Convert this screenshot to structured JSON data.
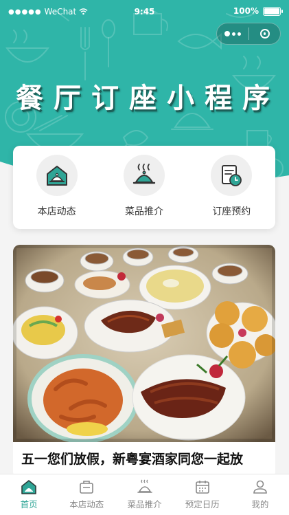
{
  "status_bar": {
    "carrier": "WeChat",
    "time": "9:45",
    "battery": "100%"
  },
  "header": {
    "title": "餐厅订座小程序",
    "color": "#2fb5a8"
  },
  "nav": {
    "items": [
      {
        "label": "本店动态",
        "icon": "house-cloche-icon"
      },
      {
        "label": "菜品推介",
        "icon": "steaming-cloche-icon"
      },
      {
        "label": "订座预约",
        "icon": "booking-clock-icon"
      }
    ]
  },
  "news": {
    "title": "五一您们放假，新粤宴酒家同您一起放",
    "image": "banquet-dishes-photo"
  },
  "tabbar": {
    "items": [
      {
        "label": "首页",
        "icon": "home-icon",
        "active": true
      },
      {
        "label": "本店动态",
        "icon": "bag-icon",
        "active": false
      },
      {
        "label": "菜品推介",
        "icon": "cloche-icon",
        "active": false
      },
      {
        "label": "预定日历",
        "icon": "calendar-icon",
        "active": false
      },
      {
        "label": "我的",
        "icon": "user-icon",
        "active": false
      }
    ],
    "active_color": "#2fa596"
  }
}
